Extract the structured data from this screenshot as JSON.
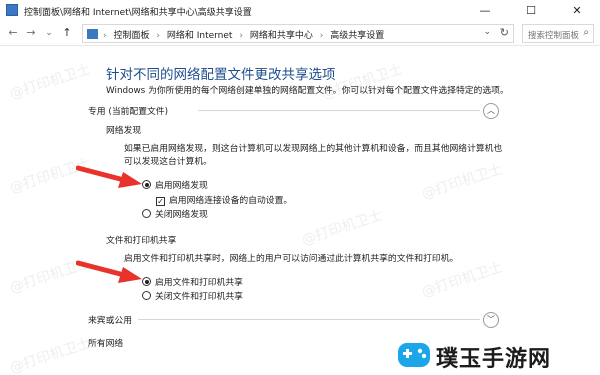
{
  "window": {
    "title": "控制面板\\网络和 Internet\\网络和共享中心\\高级共享设置",
    "minimize": "—",
    "maximize": "☐",
    "close": "✕"
  },
  "nav": {
    "back": "←",
    "forward": "→",
    "dropdown": "⌄",
    "up": "↑",
    "breadcrumb_root": "›",
    "breadcrumbs": [
      "控制面板",
      "网络和 Internet",
      "网络和共享中心",
      "高级共享设置"
    ],
    "breadcrumb_sep": "›",
    "address_dropdown": "⌄",
    "refresh": "↻",
    "search_placeholder": "搜索控制面板",
    "search_icon": "⌕"
  },
  "page": {
    "heading": "针对不同的网络配置文件更改共享选项",
    "intro": "Windows 为你所使用的每个网络创建单独的网络配置文件。你可以针对每个配置文件选择特定的选项。"
  },
  "private_section": {
    "title": "专用 (当前配置文件)",
    "chevron": "︿",
    "network_discovery": {
      "title": "网络发现",
      "description": "如果已启用网络发现，则这台计算机可以发现网络上的其他计算机和设备，而且其他网络计算机也可以发现这台计算机。",
      "options": [
        {
          "label": "启用网络发现",
          "selected": true
        },
        {
          "label": "关闭网络发现",
          "selected": false
        }
      ],
      "auto_setup": {
        "label": "启用网络连接设备的自动设置。",
        "checked": true,
        "mark": "✓"
      }
    },
    "file_printer_sharing": {
      "title": "文件和打印机共享",
      "description": "启用文件和打印机共享时，网络上的用户可以访问通过此计算机共享的文件和打印机。",
      "options": [
        {
          "label": "启用文件和打印机共享",
          "selected": true
        },
        {
          "label": "关闭文件和打印机共享",
          "selected": false
        }
      ]
    }
  },
  "guest_section": {
    "title": "来宾或公用",
    "chevron": "﹀"
  },
  "all_networks_section": {
    "title": "所有网络"
  },
  "watermark": {
    "text": "@打印机卫士"
  },
  "logo": {
    "text": "璞玉手游网"
  },
  "colors": {
    "heading": "#1e4d8c",
    "arrow": "#e8322c",
    "logo_accent": "#1aa6e8"
  }
}
